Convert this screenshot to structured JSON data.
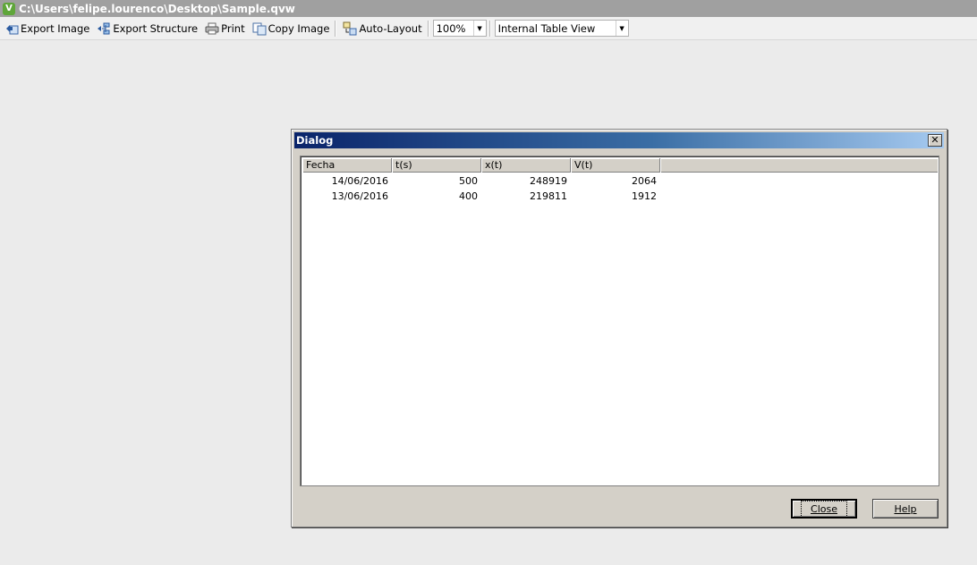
{
  "window": {
    "title": "C:\\Users\\felipe.lourenco\\Desktop\\Sample.qvw",
    "app_icon_letter": "V"
  },
  "toolbar": {
    "export_image": "Export Image",
    "export_structure": "Export Structure",
    "print": "Print",
    "copy_image": "Copy Image",
    "auto_layout": "Auto-Layout",
    "zoom": "100%",
    "view_select": "Internal Table View"
  },
  "dialog": {
    "title": "Dialog",
    "columns": [
      "Fecha",
      "t(s)",
      "x(t)",
      "V(t)"
    ],
    "rows": [
      [
        "14/06/2016",
        "500",
        "248919",
        "2064"
      ],
      [
        "13/06/2016",
        "400",
        "219811",
        "1912"
      ]
    ],
    "close_label": "Close",
    "help_label": "Help"
  },
  "colors": {
    "desktop_bg": "#ebebeb",
    "dialog_title_start": "#0a246a",
    "dialog_title_end": "#a6caf0",
    "app_icon": "#5fa63a"
  }
}
